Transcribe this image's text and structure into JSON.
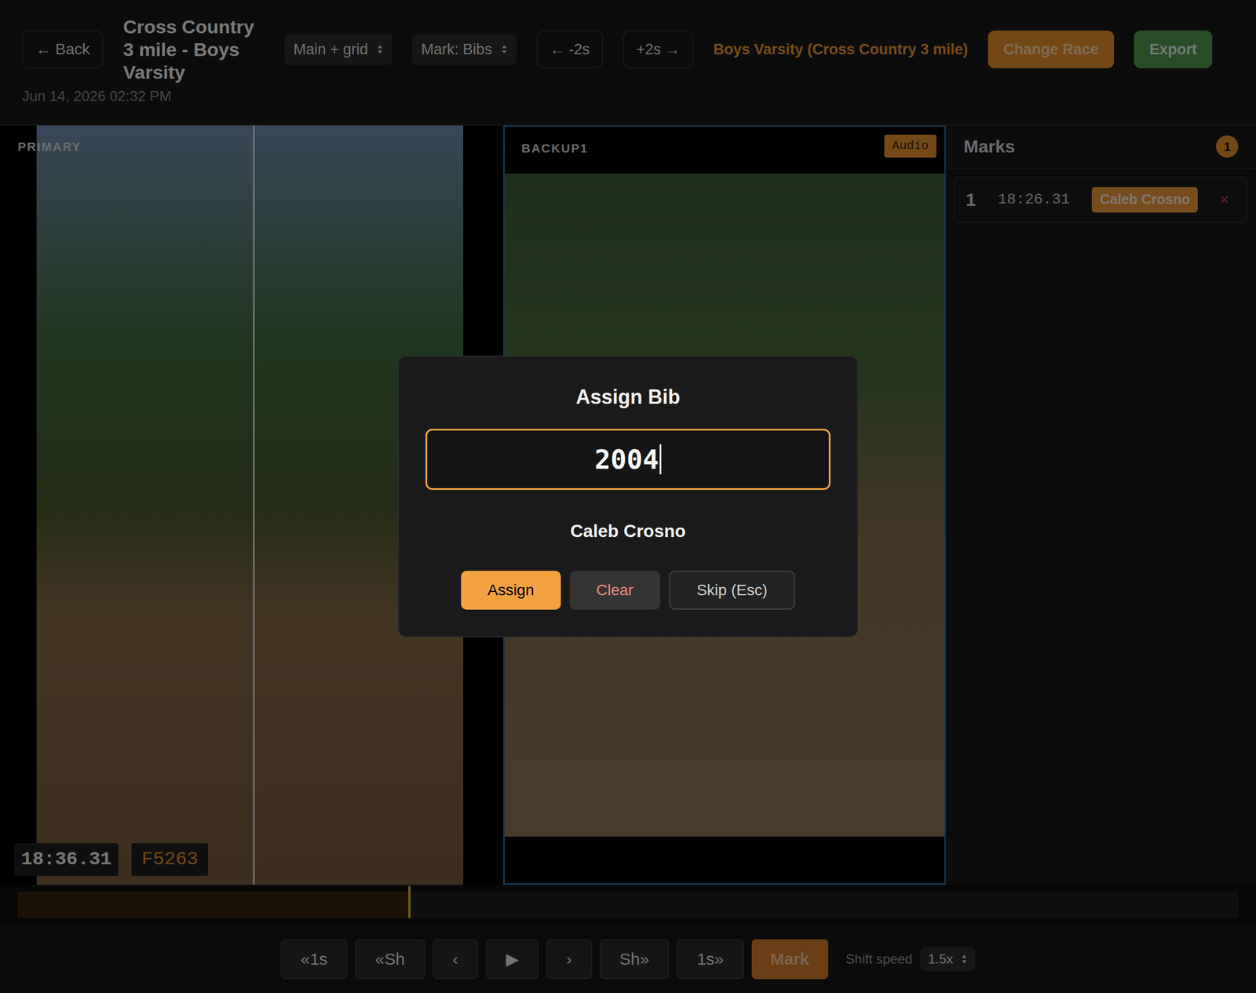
{
  "header": {
    "back": "← Back",
    "title": "Cross Country 3 mile - Boys Varsity",
    "date": "Jun 14, 2026 02:32 PM",
    "view_select": "Main + grid",
    "mark_select": "Mark: Bibs",
    "step_back": "← -2s",
    "step_forward": "+2s →",
    "race_label": "Boys Varsity (Cross Country 3 mile)",
    "change_race": "Change Race",
    "export": "Export"
  },
  "panels": [
    {
      "label": "PRIMARY",
      "badge": "",
      "selected": false
    },
    {
      "label": "BACKUP1",
      "badge": "Audio",
      "selected": true
    }
  ],
  "primary_overlay": {
    "time": "18:36.31",
    "frame": "F5263"
  },
  "marks": {
    "title": "Marks",
    "count": "1",
    "items": [
      {
        "index": "1",
        "time": "18:26.31",
        "name": "Caleb Crosno",
        "remove": "×"
      }
    ]
  },
  "timeline": {
    "level": 0.32
  },
  "controls": {
    "buttons": [
      {
        "label": "«1s",
        "kind": "step"
      },
      {
        "label": "«Sh",
        "kind": "step"
      },
      {
        "label": "‹",
        "kind": "step"
      },
      {
        "label": "▶",
        "kind": "play"
      },
      {
        "label": "›",
        "kind": "step"
      },
      {
        "label": "Sh»",
        "kind": "step"
      },
      {
        "label": "1s»",
        "kind": "step"
      },
      {
        "label": "Mark",
        "kind": "mark"
      }
    ],
    "shift_label": "Shift speed",
    "shift_value": "1.5x"
  },
  "modal": {
    "title": "Assign Bib",
    "value": "2004",
    "name": "Caleb Crosno",
    "buttons": [
      {
        "label": "Assign",
        "kind": "primary"
      },
      {
        "label": "Clear",
        "kind": "danger"
      },
      {
        "label": "Skip (Esc)",
        "kind": "secondary"
      }
    ]
  }
}
